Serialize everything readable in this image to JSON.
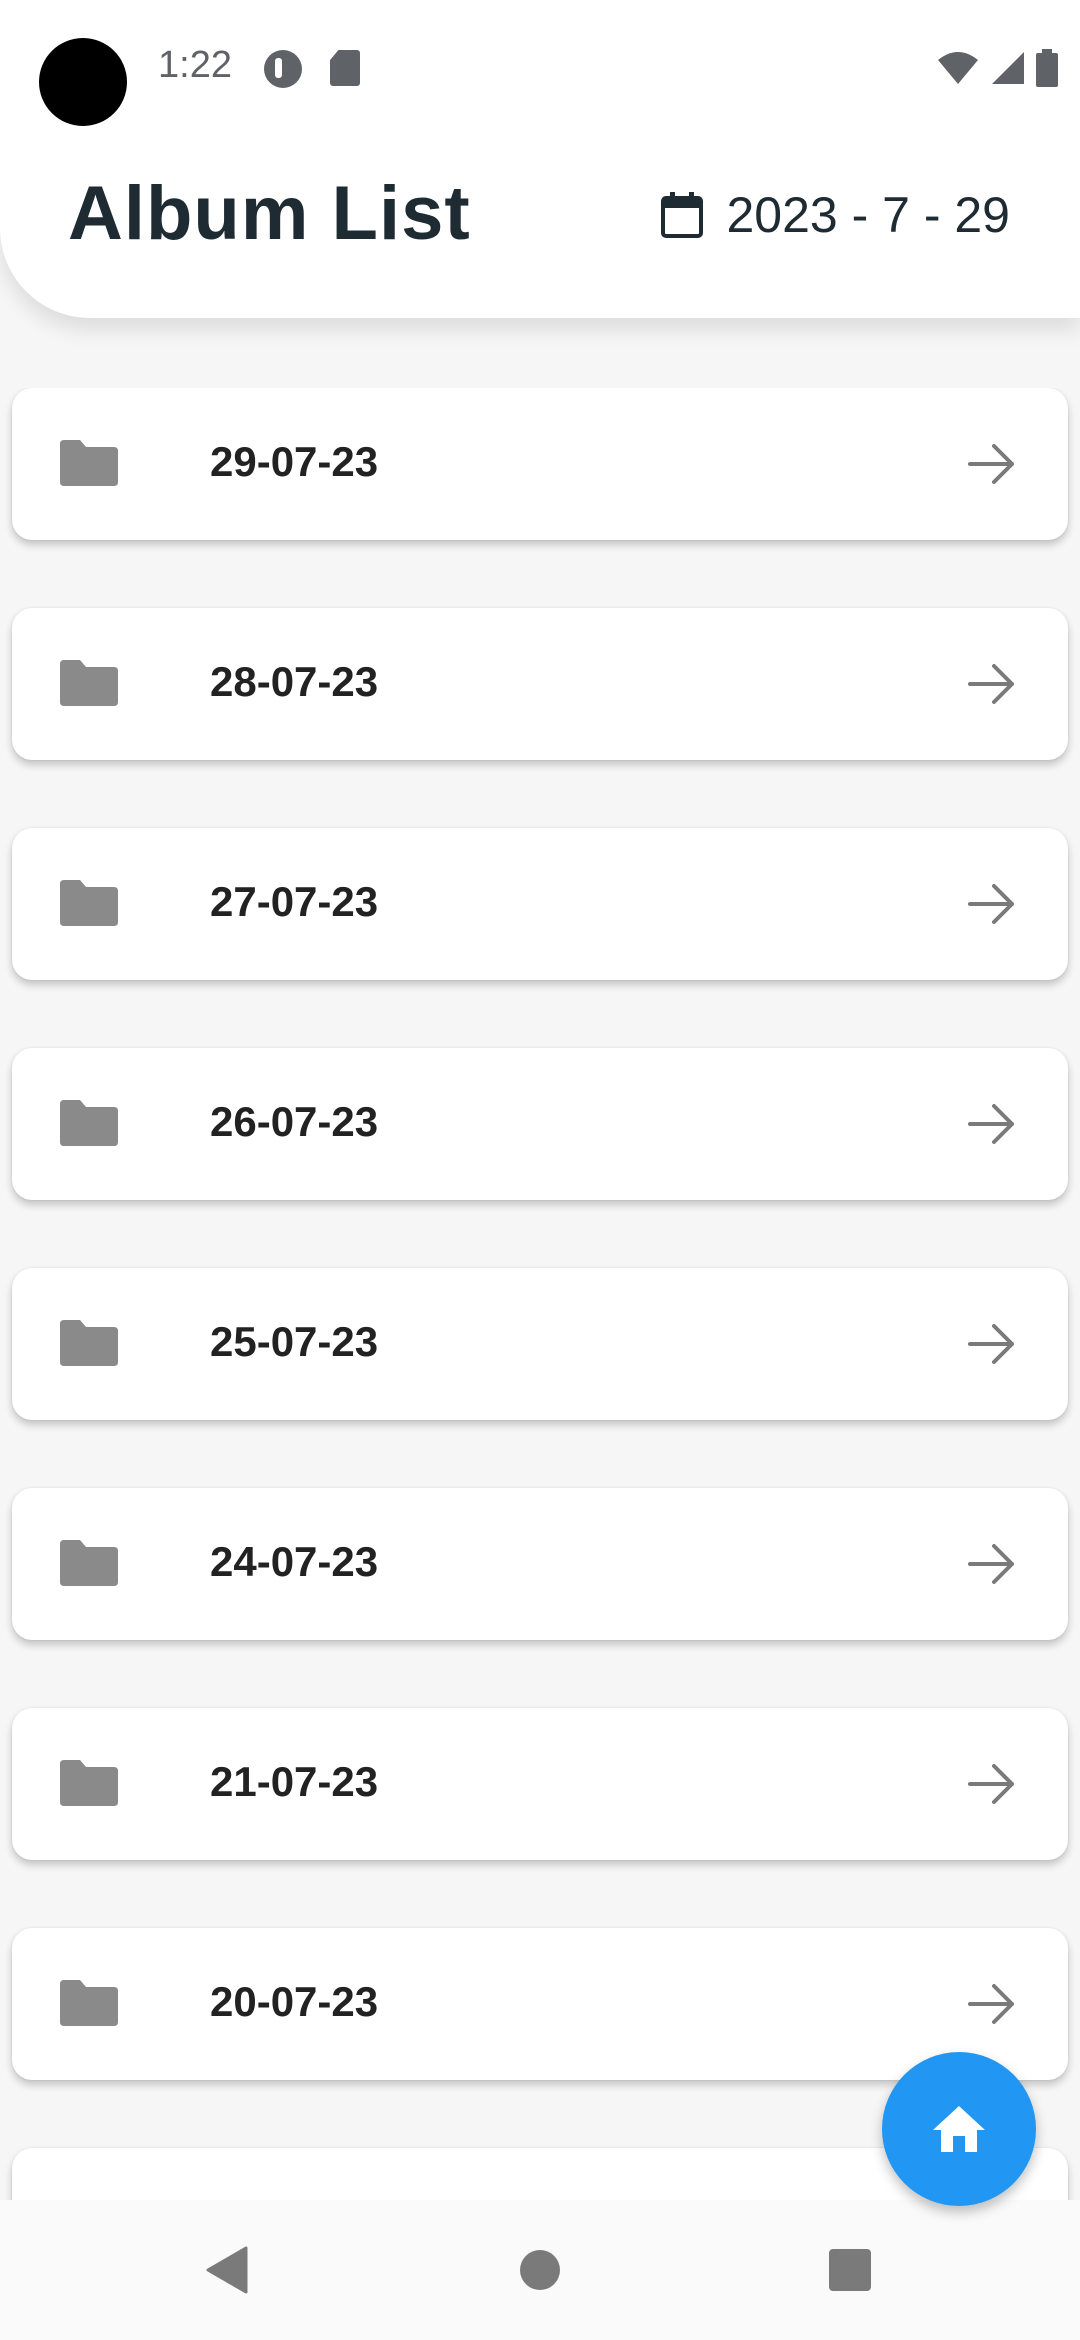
{
  "status_bar": {
    "time": "1:22"
  },
  "header": {
    "title": "Album List",
    "date": "2023 - 7 - 29"
  },
  "albums": [
    {
      "label": "29-07-23"
    },
    {
      "label": "28-07-23"
    },
    {
      "label": "27-07-23"
    },
    {
      "label": "26-07-23"
    },
    {
      "label": "25-07-23"
    },
    {
      "label": "24-07-23"
    },
    {
      "label": "21-07-23"
    },
    {
      "label": "20-07-23"
    }
  ],
  "icons": {
    "status": [
      "camera-cutout",
      "app-notification-icon",
      "sd-card-icon",
      "wifi-icon",
      "signal-icon",
      "battery-icon"
    ],
    "header": "calendar-icon",
    "list_item_leading": "folder-icon",
    "list_item_trailing": "arrow-right-icon",
    "fab": "home-icon",
    "navigation": [
      "back-icon",
      "home-circle-icon",
      "recents-icon"
    ]
  },
  "colors": {
    "accent": "#2196f3",
    "title": "#1e2b33",
    "folder": "#8a8a8a",
    "background": "#f6f6f6"
  }
}
